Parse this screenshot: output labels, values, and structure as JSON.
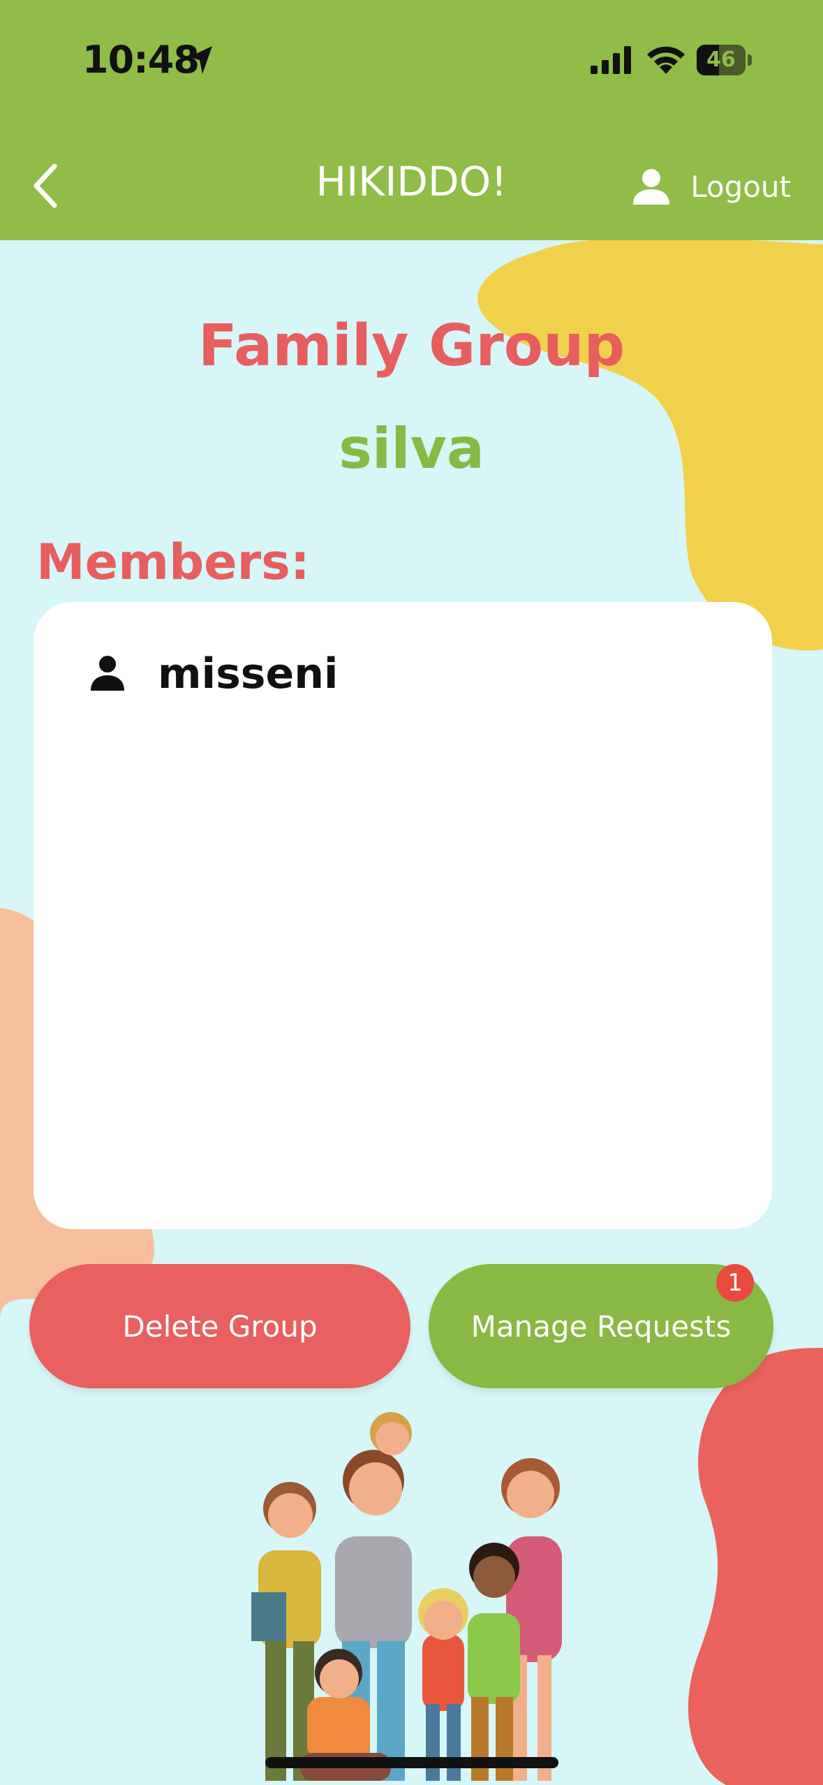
{
  "status_bar": {
    "time": "10:48",
    "battery": "46",
    "battery_level": 0.46
  },
  "nav": {
    "title": "HIKIDDO!",
    "logout_label": "Logout"
  },
  "page": {
    "heading": "Family Group",
    "group_name": "silva",
    "members_label": "Members:"
  },
  "members": [
    {
      "name": "misseni"
    }
  ],
  "actions": {
    "delete_label": "Delete Group",
    "manage_label": "Manage Requests",
    "requests_badge": "1"
  },
  "colors": {
    "header_green": "#8FBD48",
    "background": "#D6F6F8",
    "accent_red": "#E85E5E",
    "accent_green": "#8AB844",
    "blob_yellow": "#F1D14C",
    "blob_peach": "#F7BE9B",
    "blob_red": "#EA625E"
  },
  "icons": [
    "location-arrow-icon",
    "signal-icon",
    "wifi-icon",
    "battery-icon",
    "back-chevron-icon",
    "user-icon",
    "member-user-icon"
  ]
}
